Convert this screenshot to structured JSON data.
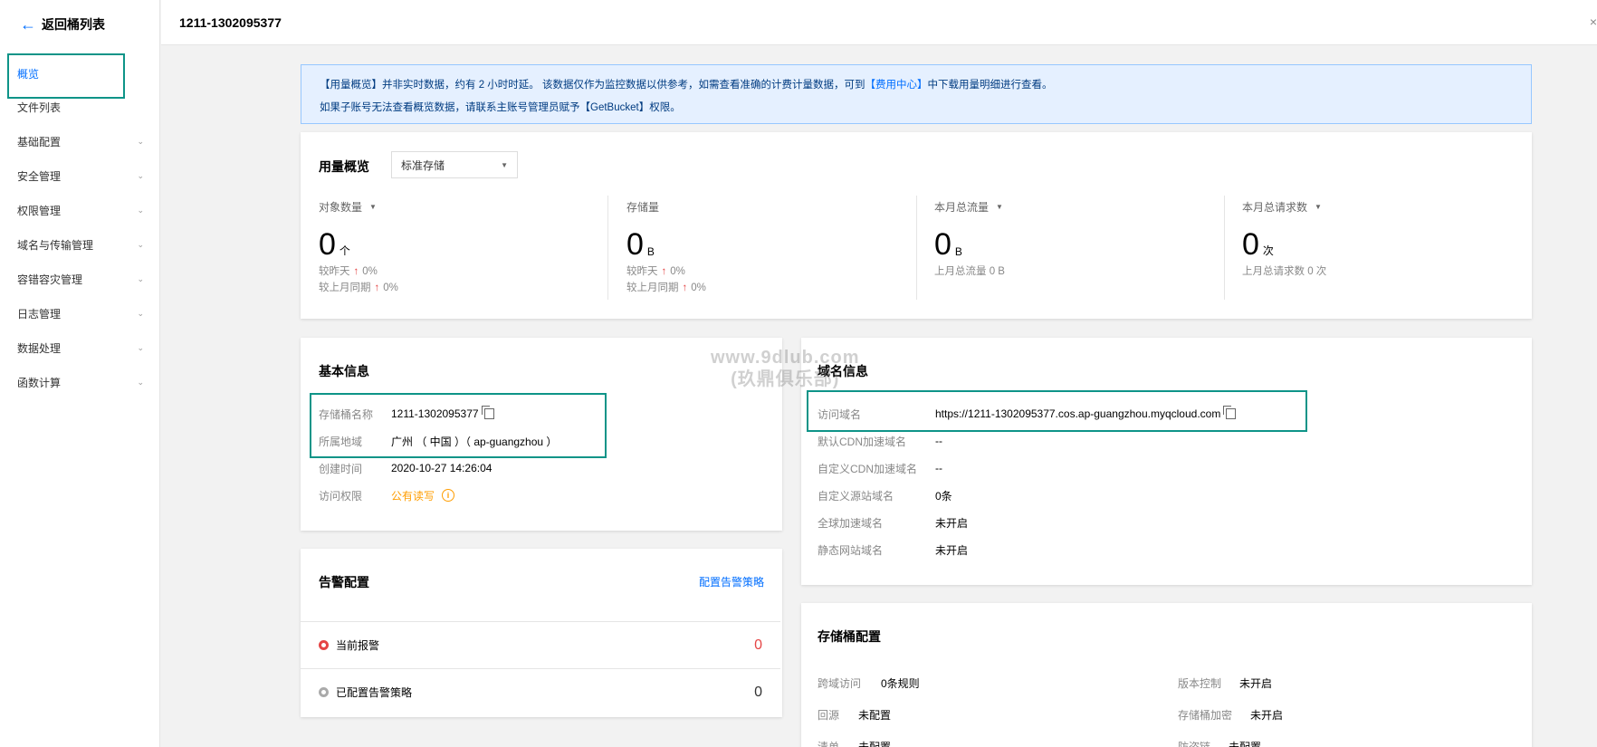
{
  "sidebar": {
    "back_label": "返回桶列表",
    "items": [
      {
        "label": "概览",
        "has_chevron": false,
        "active": true
      },
      {
        "label": "文件列表",
        "has_chevron": false
      },
      {
        "label": "基础配置",
        "has_chevron": true
      },
      {
        "label": "安全管理",
        "has_chevron": true
      },
      {
        "label": "权限管理",
        "has_chevron": true
      },
      {
        "label": "域名与传输管理",
        "has_chevron": true
      },
      {
        "label": "容错容灾管理",
        "has_chevron": true
      },
      {
        "label": "日志管理",
        "has_chevron": true
      },
      {
        "label": "数据处理",
        "has_chevron": true
      },
      {
        "label": "函数计算",
        "has_chevron": true
      }
    ]
  },
  "header": {
    "title": "1211-1302095377",
    "close": "×"
  },
  "notice": {
    "line1_prefix": "【用量概览】并非实时数据，约有 2 小时时延。 该数据仅作为监控数据以供参考，如需查看准确的计费计量数据，可到",
    "line1_link": "【费用中心】",
    "line1_suffix": "中下载用量明细进行查看。",
    "line2": "如果子账号无法查看概览数据，请联系主账号管理员赋予【GetBucket】权限。"
  },
  "usage": {
    "title": "用量概览",
    "storage_class": "标准存储",
    "stats": [
      {
        "label": "对象数量",
        "dropdown": true,
        "value": "0",
        "unit": "个",
        "sub1_label": "较昨天",
        "sub1_value": "0%",
        "sub2_label": "较上月同期",
        "sub2_value": "0%"
      },
      {
        "label": "存储量",
        "dropdown": false,
        "value": "0",
        "unit": "B",
        "sub1_label": "较昨天",
        "sub1_value": "0%",
        "sub2_label": "较上月同期",
        "sub2_value": "0%"
      },
      {
        "label": "本月总流量",
        "dropdown": true,
        "value": "0",
        "unit": "B",
        "sub_text": "上月总流量 0 B"
      },
      {
        "label": "本月总请求数",
        "dropdown": true,
        "value": "0",
        "unit": "次",
        "sub_text": "上月总请求数 0 次"
      }
    ]
  },
  "basic_info": {
    "title": "基本信息",
    "rows": [
      {
        "key": "存储桶名称",
        "value": "1211-1302095377"
      },
      {
        "key": "所属地域",
        "value": "广州 （ 中国 ）（ ap-guangzhou ）"
      },
      {
        "key": "创建时间",
        "value": "2020-10-27 14:26:04"
      },
      {
        "key": "访问权限",
        "value": "公有读写"
      }
    ]
  },
  "domain_info": {
    "title": "域名信息",
    "rows": [
      {
        "key": "访问域名",
        "value": "https://1211-1302095377.cos.ap-guangzhou.myqcloud.com"
      },
      {
        "key": "默认CDN加速域名",
        "value": "--"
      },
      {
        "key": "自定义CDN加速域名",
        "value": "--"
      },
      {
        "key": "自定义源站域名",
        "value": "0条"
      },
      {
        "key": "全球加速域名",
        "value": "未开启"
      },
      {
        "key": "静态网站域名",
        "value": "未开启"
      }
    ]
  },
  "alarm": {
    "title": "告警配置",
    "link": "配置告警策略",
    "rows": [
      {
        "label": "当前报警",
        "count": "0"
      },
      {
        "label": "已配置告警策略",
        "count": "0"
      }
    ]
  },
  "bucket_config": {
    "title": "存储桶配置",
    "left": [
      {
        "key": "跨域访问",
        "value": "0条规则"
      },
      {
        "key": "回源",
        "value": "未配置"
      },
      {
        "key": "清单",
        "value": "未配置"
      }
    ],
    "right": [
      {
        "key": "版本控制",
        "value": "未开启"
      },
      {
        "key": "存储桶加密",
        "value": "未开启"
      },
      {
        "key": "防盗链",
        "value": "未配置"
      }
    ]
  },
  "watermark": {
    "line1": "www.9dlub.com",
    "line2": "(玖鼎俱乐部)"
  },
  "colors": {
    "accent": "#006eff",
    "highlight_box": "#0e9488",
    "up_arrow": "#e54545",
    "warning": "#ff9d00",
    "alarm_red": "#e54545"
  }
}
